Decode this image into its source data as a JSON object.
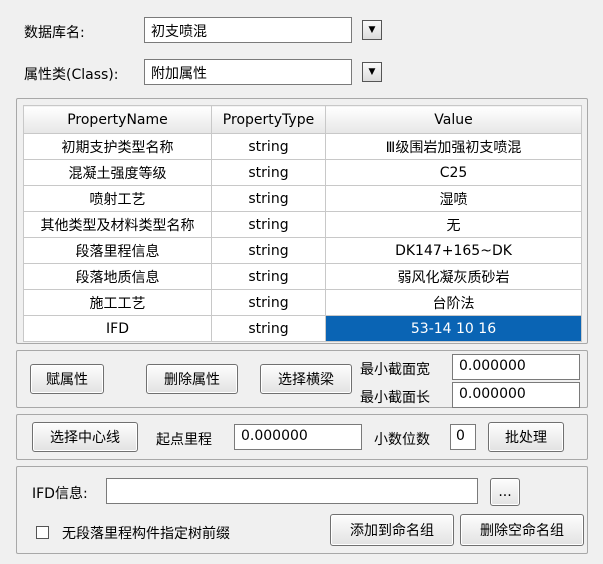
{
  "database": {
    "label": "数据库名:",
    "value": "初支喷混"
  },
  "class": {
    "label": "属性类(Class):",
    "value": "附加属性"
  },
  "property_table": {
    "columns": [
      "PropertyName",
      "PropertyType",
      "Value"
    ],
    "rows": [
      {
        "name": "初期支护类型名称",
        "type": "string",
        "value": "Ⅲ级围岩加强初支喷混"
      },
      {
        "name": "混凝土强度等级",
        "type": "string",
        "value": "C25"
      },
      {
        "name": "喷射工艺",
        "type": "string",
        "value": "湿喷"
      },
      {
        "name": "其他类型及材料类型名称",
        "type": "string",
        "value": "无"
      },
      {
        "name": "段落里程信息",
        "type": "string",
        "value": "DK147+165~DK"
      },
      {
        "name": "段落地质信息",
        "type": "string",
        "value": "弱风化凝灰质砂岩"
      },
      {
        "name": "施工工艺",
        "type": "string",
        "value": "台阶法"
      },
      {
        "name": "IFD",
        "type": "string",
        "value": "53-14 10 16"
      }
    ]
  },
  "attr_panel": {
    "assign_btn": "赋属性",
    "delete_btn": "删除属性",
    "select_beam_btn": "选择横梁",
    "min_width_label": "最小截面宽",
    "min_width_value": "0.000000",
    "min_length_label": "最小截面长",
    "min_length_value": "0.000000"
  },
  "centerline_panel": {
    "select_centerline_btn": "选择中心线",
    "start_mileage_label": "起点里程",
    "start_mileage_value": "0.000000",
    "decimals_label": "小数位数",
    "decimals_value": "0",
    "batch_btn": "批处理"
  },
  "ifd_panel": {
    "ifd_label": "IFD信息:",
    "ifd_value": "",
    "browse_btn": "...",
    "checkbox_label": "无段落里程构件指定树前缀",
    "add_group_btn": "添加到命名组",
    "delete_group_btn": "删除空命名组"
  }
}
